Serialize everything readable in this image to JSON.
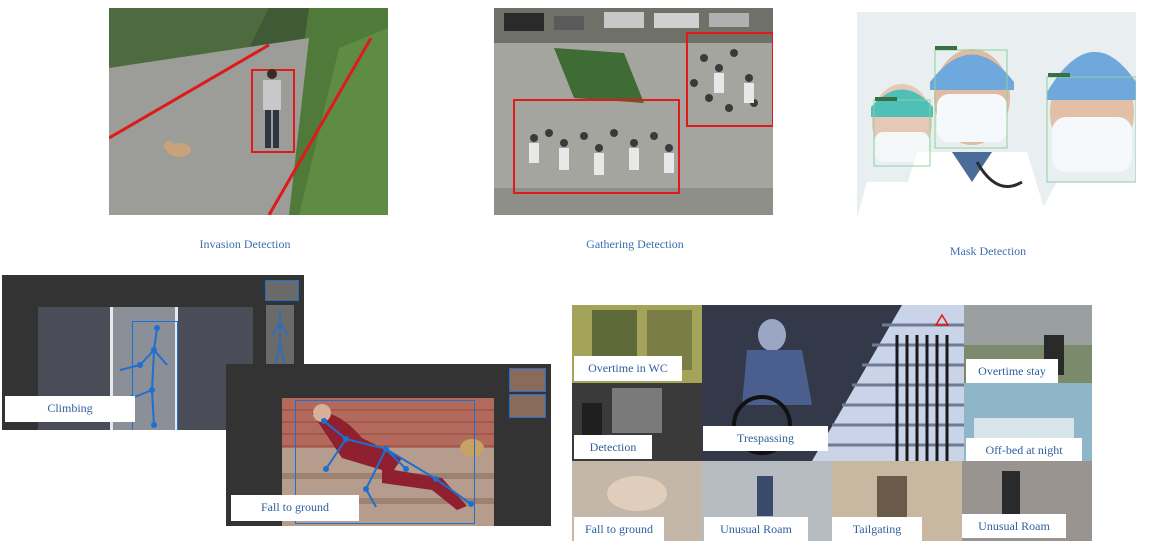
{
  "top_row": {
    "invasion_caption": "Invasion Detection",
    "gathering_caption": "Gathering Detection",
    "mask_caption": "Mask Detection"
  },
  "left_panels": {
    "climbing_label": "Climbing",
    "fall_label": "Fall to ground"
  },
  "grid": {
    "overtime_wc": "Overtime in WC",
    "detection": "Detection",
    "trespassing": "Trespassing",
    "overtime_stay": "Overtime stay",
    "offbed": "Off-bed at night",
    "fall": "Fall to ground",
    "unusual_roam_1": "Unusual Roam",
    "tailgating": "Tailgating",
    "unusual_roam_2": "Unusual Roam"
  },
  "colors": {
    "caption": "#3d6fb0",
    "alert_red": "#e01a1a",
    "skeleton_blue": "#1e6fd0",
    "mask_green": "#8fd19e"
  }
}
